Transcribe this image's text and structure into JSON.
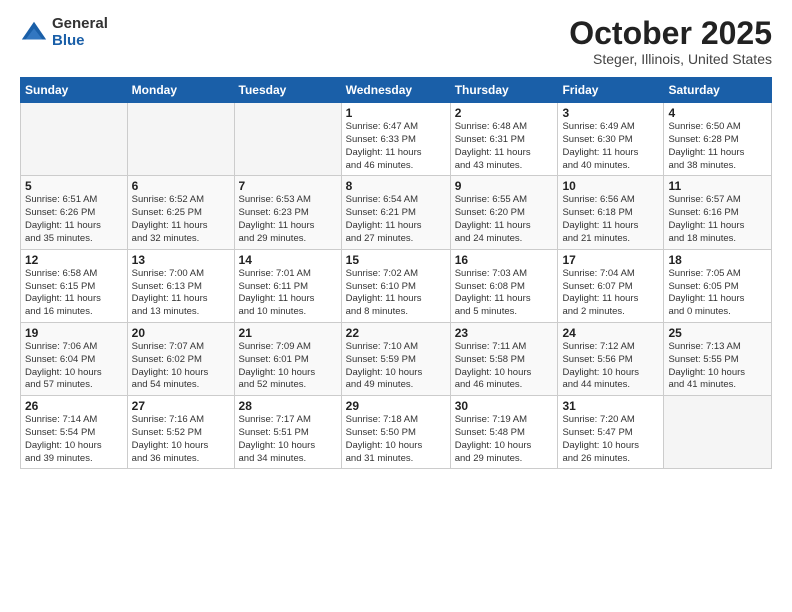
{
  "logo": {
    "general": "General",
    "blue": "Blue"
  },
  "title": "October 2025",
  "location": "Steger, Illinois, United States",
  "weekdays": [
    "Sunday",
    "Monday",
    "Tuesday",
    "Wednesday",
    "Thursday",
    "Friday",
    "Saturday"
  ],
  "weeks": [
    [
      {
        "day": "",
        "info": ""
      },
      {
        "day": "",
        "info": ""
      },
      {
        "day": "",
        "info": ""
      },
      {
        "day": "1",
        "info": "Sunrise: 6:47 AM\nSunset: 6:33 PM\nDaylight: 11 hours\nand 46 minutes."
      },
      {
        "day": "2",
        "info": "Sunrise: 6:48 AM\nSunset: 6:31 PM\nDaylight: 11 hours\nand 43 minutes."
      },
      {
        "day": "3",
        "info": "Sunrise: 6:49 AM\nSunset: 6:30 PM\nDaylight: 11 hours\nand 40 minutes."
      },
      {
        "day": "4",
        "info": "Sunrise: 6:50 AM\nSunset: 6:28 PM\nDaylight: 11 hours\nand 38 minutes."
      }
    ],
    [
      {
        "day": "5",
        "info": "Sunrise: 6:51 AM\nSunset: 6:26 PM\nDaylight: 11 hours\nand 35 minutes."
      },
      {
        "day": "6",
        "info": "Sunrise: 6:52 AM\nSunset: 6:25 PM\nDaylight: 11 hours\nand 32 minutes."
      },
      {
        "day": "7",
        "info": "Sunrise: 6:53 AM\nSunset: 6:23 PM\nDaylight: 11 hours\nand 29 minutes."
      },
      {
        "day": "8",
        "info": "Sunrise: 6:54 AM\nSunset: 6:21 PM\nDaylight: 11 hours\nand 27 minutes."
      },
      {
        "day": "9",
        "info": "Sunrise: 6:55 AM\nSunset: 6:20 PM\nDaylight: 11 hours\nand 24 minutes."
      },
      {
        "day": "10",
        "info": "Sunrise: 6:56 AM\nSunset: 6:18 PM\nDaylight: 11 hours\nand 21 minutes."
      },
      {
        "day": "11",
        "info": "Sunrise: 6:57 AM\nSunset: 6:16 PM\nDaylight: 11 hours\nand 18 minutes."
      }
    ],
    [
      {
        "day": "12",
        "info": "Sunrise: 6:58 AM\nSunset: 6:15 PM\nDaylight: 11 hours\nand 16 minutes."
      },
      {
        "day": "13",
        "info": "Sunrise: 7:00 AM\nSunset: 6:13 PM\nDaylight: 11 hours\nand 13 minutes."
      },
      {
        "day": "14",
        "info": "Sunrise: 7:01 AM\nSunset: 6:11 PM\nDaylight: 11 hours\nand 10 minutes."
      },
      {
        "day": "15",
        "info": "Sunrise: 7:02 AM\nSunset: 6:10 PM\nDaylight: 11 hours\nand 8 minutes."
      },
      {
        "day": "16",
        "info": "Sunrise: 7:03 AM\nSunset: 6:08 PM\nDaylight: 11 hours\nand 5 minutes."
      },
      {
        "day": "17",
        "info": "Sunrise: 7:04 AM\nSunset: 6:07 PM\nDaylight: 11 hours\nand 2 minutes."
      },
      {
        "day": "18",
        "info": "Sunrise: 7:05 AM\nSunset: 6:05 PM\nDaylight: 11 hours\nand 0 minutes."
      }
    ],
    [
      {
        "day": "19",
        "info": "Sunrise: 7:06 AM\nSunset: 6:04 PM\nDaylight: 10 hours\nand 57 minutes."
      },
      {
        "day": "20",
        "info": "Sunrise: 7:07 AM\nSunset: 6:02 PM\nDaylight: 10 hours\nand 54 minutes."
      },
      {
        "day": "21",
        "info": "Sunrise: 7:09 AM\nSunset: 6:01 PM\nDaylight: 10 hours\nand 52 minutes."
      },
      {
        "day": "22",
        "info": "Sunrise: 7:10 AM\nSunset: 5:59 PM\nDaylight: 10 hours\nand 49 minutes."
      },
      {
        "day": "23",
        "info": "Sunrise: 7:11 AM\nSunset: 5:58 PM\nDaylight: 10 hours\nand 46 minutes."
      },
      {
        "day": "24",
        "info": "Sunrise: 7:12 AM\nSunset: 5:56 PM\nDaylight: 10 hours\nand 44 minutes."
      },
      {
        "day": "25",
        "info": "Sunrise: 7:13 AM\nSunset: 5:55 PM\nDaylight: 10 hours\nand 41 minutes."
      }
    ],
    [
      {
        "day": "26",
        "info": "Sunrise: 7:14 AM\nSunset: 5:54 PM\nDaylight: 10 hours\nand 39 minutes."
      },
      {
        "day": "27",
        "info": "Sunrise: 7:16 AM\nSunset: 5:52 PM\nDaylight: 10 hours\nand 36 minutes."
      },
      {
        "day": "28",
        "info": "Sunrise: 7:17 AM\nSunset: 5:51 PM\nDaylight: 10 hours\nand 34 minutes."
      },
      {
        "day": "29",
        "info": "Sunrise: 7:18 AM\nSunset: 5:50 PM\nDaylight: 10 hours\nand 31 minutes."
      },
      {
        "day": "30",
        "info": "Sunrise: 7:19 AM\nSunset: 5:48 PM\nDaylight: 10 hours\nand 29 minutes."
      },
      {
        "day": "31",
        "info": "Sunrise: 7:20 AM\nSunset: 5:47 PM\nDaylight: 10 hours\nand 26 minutes."
      },
      {
        "day": "",
        "info": ""
      }
    ]
  ]
}
